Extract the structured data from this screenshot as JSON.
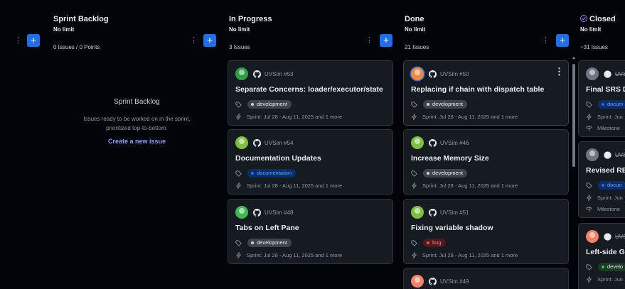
{
  "columns": {
    "backlog": {
      "title": "Sprint Backlog",
      "limit": "No limit",
      "count": "0 Issues / 0 Points",
      "empty_title": "Sprint Backlog",
      "empty_desc_line1": "Issues ready to be worked on in the sprint,",
      "empty_desc_line2": "prioritized top-to-bottom.",
      "create_link": "Create a new issue"
    },
    "in_progress": {
      "title": "In Progress",
      "limit": "No limit",
      "count": "3 Issues",
      "cards": [
        {
          "ref": "UVSim #53",
          "title": "Separate Concerns: loader/executor/state",
          "label": "development",
          "sprint": "Sprint: Jul 28 - Aug 11, 2025 and 1 more"
        },
        {
          "ref": "UVSim #54",
          "title": "Documentation Updates",
          "label": "documentation",
          "sprint": "Sprint: Jul 28 - Aug 11, 2025 and 1 more"
        },
        {
          "ref": "UVSim #48",
          "title": "Tabs on Left Pane",
          "label": "development",
          "sprint": "Sprint: Jul 28 - Aug 11, 2025 and 1 more"
        }
      ]
    },
    "done": {
      "title": "Done",
      "limit": "No limit",
      "count": "21 Issues",
      "cards": [
        {
          "ref": "UVSim #50",
          "title": "Replacing if chain with dispatch table",
          "label": "development",
          "sprint": "Sprint: Jul 28 - Aug 11, 2025 and 1 more",
          "kebab": "⋮"
        },
        {
          "ref": "UVSim #46",
          "title": "Increase Memory Size",
          "label": "development",
          "sprint": "Sprint: Jul 28 - Aug 11, 2025 and 1 more"
        },
        {
          "ref": "UVSim #51",
          "title": "Fixing variable shadow",
          "label": "bug",
          "sprint": "Sprint: Jul 28 - Aug 11, 2025 and 1 more"
        },
        {
          "ref": "UVSim #49"
        }
      ]
    },
    "closed": {
      "title": "Closed",
      "limit": "No limit",
      "count": "~31 Issues",
      "cards": [
        {
          "ref": "UVS",
          "title": "Final SRS D",
          "label": "docum",
          "sprint": "Sprint: Jun",
          "milestone": "Milestone"
        },
        {
          "ref": "UVS",
          "title": "Revised REA",
          "label": "docun",
          "sprint": "Sprint: Jun",
          "milestone": "Milestone"
        },
        {
          "ref": "UVS",
          "title": "Left-side GU",
          "label": "develo",
          "sprint": "Sprint: Jun"
        }
      ]
    }
  },
  "controls": {
    "add_symbol": "+",
    "dots_symbol": "⋮",
    "scroll_up_symbol": "▲"
  },
  "colors": {
    "accent_blue": "#1f6feb",
    "label_development_bg": "#3d444d",
    "label_development_dot": "#c9d1d9",
    "label_documentation_bg": "#0c2d6b",
    "label_documentation_dot": "#1f6feb",
    "label_bug_bg": "#4a1a20",
    "label_bug_dot": "#f85149",
    "closed_purple": "#a371f7"
  }
}
